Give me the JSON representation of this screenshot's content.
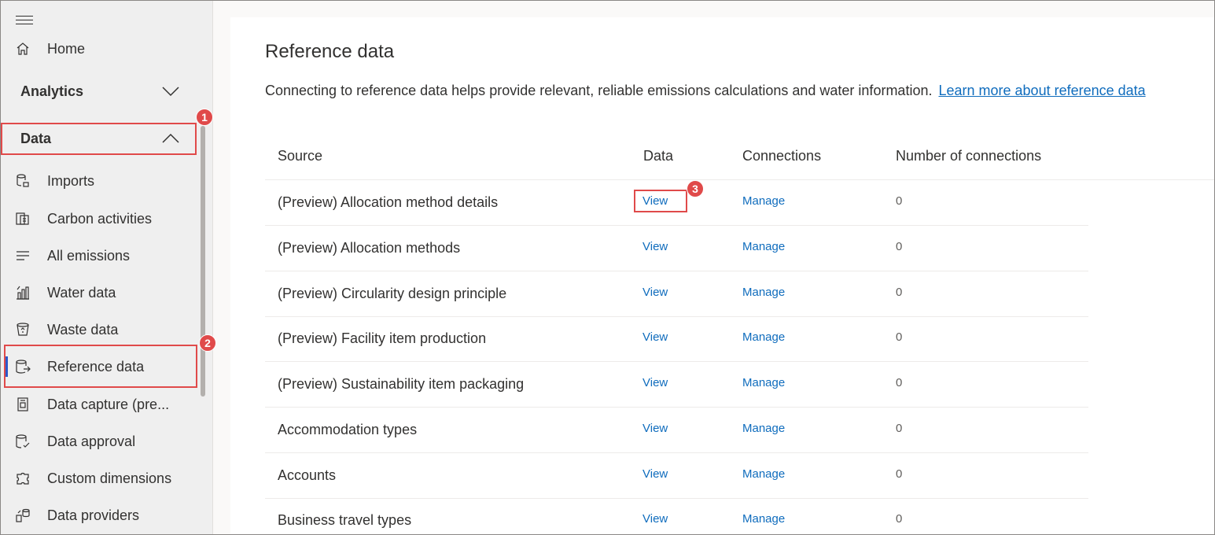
{
  "sidebar": {
    "home": "Home",
    "analytics": "Analytics",
    "data_group": "Data",
    "items": [
      {
        "label": "Imports",
        "icon": "imports-icon"
      },
      {
        "label": "Carbon activities",
        "icon": "carbon-activities-icon"
      },
      {
        "label": "All emissions",
        "icon": "list-icon"
      },
      {
        "label": "Water data",
        "icon": "water-chart-icon"
      },
      {
        "label": "Waste data",
        "icon": "waste-bin-icon"
      },
      {
        "label": "Reference data",
        "icon": "database-export-icon"
      },
      {
        "label": "Data capture (pre...",
        "icon": "form-icon"
      },
      {
        "label": "Data approval",
        "icon": "database-check-icon"
      },
      {
        "label": "Custom dimensions",
        "icon": "puzzle-icon"
      },
      {
        "label": "Data providers",
        "icon": "providers-icon"
      }
    ]
  },
  "callouts": [
    "1",
    "2",
    "3"
  ],
  "main": {
    "title": "Reference data",
    "description": "Connecting to reference data helps provide relevant, reliable emissions calculations and water information.",
    "learn_more": "Learn more about reference data",
    "columns": [
      "Source",
      "Data",
      "Connections",
      "Number of connections"
    ],
    "rows": [
      {
        "source": "(Preview) Allocation method details",
        "data": "View",
        "connections": "Manage",
        "count": "0"
      },
      {
        "source": "(Preview) Allocation methods",
        "data": "View",
        "connections": "Manage",
        "count": "0"
      },
      {
        "source": "(Preview) Circularity design principle",
        "data": "View",
        "connections": "Manage",
        "count": "0"
      },
      {
        "source": "(Preview) Facility item production",
        "data": "View",
        "connections": "Manage",
        "count": "0"
      },
      {
        "source": "(Preview) Sustainability item packaging",
        "data": "View",
        "connections": "Manage",
        "count": "0"
      },
      {
        "source": "Accommodation types",
        "data": "View",
        "connections": "Manage",
        "count": "0"
      },
      {
        "source": "Accounts",
        "data": "View",
        "connections": "Manage",
        "count": "0"
      },
      {
        "source": "Business travel types",
        "data": "View",
        "connections": "Manage",
        "count": "0"
      }
    ]
  },
  "colors": {
    "callout": "#e04a4a",
    "link": "#0f6cbd",
    "active_indicator": "#2b58c9"
  }
}
